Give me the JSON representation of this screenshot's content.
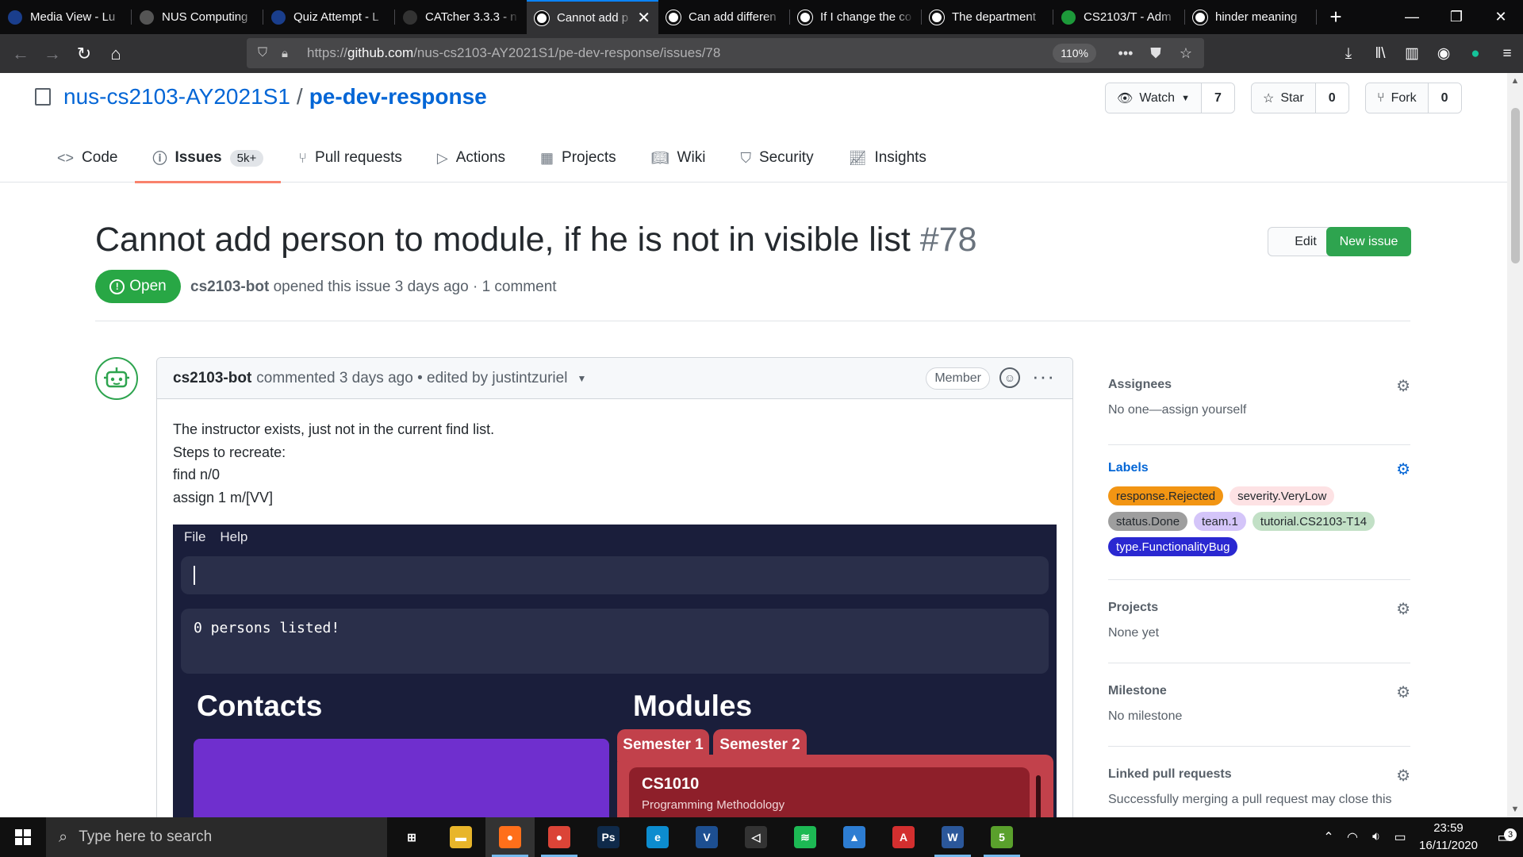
{
  "browser": {
    "tabs": [
      {
        "title": "Media View - Lu",
        "icon": "luminus-icon",
        "color": "#1a3e8c"
      },
      {
        "title": "NUS Computing",
        "icon": "shield-crest-icon",
        "color": "#555"
      },
      {
        "title": "Quiz Attempt - L",
        "icon": "luminus-icon",
        "color": "#1a3e8c"
      },
      {
        "title": "CATcher 3.3.3 - n",
        "icon": "catcher-icon",
        "color": "#333"
      },
      {
        "title": "Cannot add p",
        "icon": "github-icon",
        "color": "#fff",
        "active": true
      },
      {
        "title": "Can add differen",
        "icon": "github-icon",
        "color": "#fff"
      },
      {
        "title": "If I change the co",
        "icon": "github-icon",
        "color": "#fff"
      },
      {
        "title": "The department",
        "icon": "github-icon",
        "color": "#fff"
      },
      {
        "title": "CS2103/T - Adm",
        "icon": "graduation-cap-icon",
        "color": "#1d9a3a"
      },
      {
        "title": "hinder meaning",
        "icon": "google-icon",
        "color": "#fff"
      }
    ],
    "url_prefix": "https://",
    "url_host": "github.com",
    "url_path": "/nus-cs2103-AY2021S1/pe-dev-response/issues/78",
    "zoom": "110%"
  },
  "repo": {
    "owner": "nus-cs2103-AY2021S1",
    "separator": "/",
    "name": "pe-dev-response",
    "watch_label": "Watch",
    "watch_count": "7",
    "star_label": "Star",
    "star_count": "0",
    "fork_label": "Fork",
    "fork_count": "0",
    "nav": [
      {
        "label": "Code",
        "icon": "code-icon"
      },
      {
        "label": "Issues",
        "icon": "issue-opened-icon",
        "count": "5k+",
        "selected": true
      },
      {
        "label": "Pull requests",
        "icon": "git-pull-request-icon"
      },
      {
        "label": "Actions",
        "icon": "play-icon"
      },
      {
        "label": "Projects",
        "icon": "project-icon"
      },
      {
        "label": "Wiki",
        "icon": "book-icon"
      },
      {
        "label": "Security",
        "icon": "shield-icon"
      },
      {
        "label": "Insights",
        "icon": "graph-icon"
      }
    ]
  },
  "issue": {
    "title": "Cannot add person to module, if he is not in visible list",
    "number": "#78",
    "edit_label": "Edit",
    "new_issue_label": "New issue",
    "state": "Open",
    "author": "cs2103-bot",
    "meta_rest": "opened this issue 3 days ago · 1 comment"
  },
  "comment": {
    "author": "cs2103-bot",
    "meta": "commented 3 days ago • edited by justintzuriel",
    "badge": "Member",
    "body_lines": [
      "The instructor exists, just not in the current find list.",
      "Steps to recreate:",
      "find n/0",
      "assign 1 m/[VV]"
    ],
    "app": {
      "menu": [
        "File",
        "Help"
      ],
      "result": "0 persons listed!",
      "contacts_title": "Contacts",
      "modules_title": "Modules",
      "sem_tabs": [
        "Semester 1",
        "Semester 2"
      ],
      "module_code": "CS1010",
      "module_name": "Programming Methodology"
    }
  },
  "sidebar": {
    "assignees_title": "Assignees",
    "assignees_value": "No one—assign yourself",
    "labels_title": "Labels",
    "labels": [
      {
        "name": "response.Rejected",
        "color": "#f29513"
      },
      {
        "name": "severity.VeryLow",
        "color": "#fde2e4"
      },
      {
        "name": "status.Done",
        "color": "#9e9e9e"
      },
      {
        "name": "team.1",
        "color": "#d4c5f9"
      },
      {
        "name": "tutorial.CS2103-T14",
        "color": "#c2e0c6"
      },
      {
        "name": "type.FunctionalityBug",
        "color": "#2a28d1",
        "light_text": true
      }
    ],
    "projects_title": "Projects",
    "projects_value": "None yet",
    "milestone_title": "Milestone",
    "milestone_value": "No milestone",
    "linked_title": "Linked pull requests",
    "linked_value": "Successfully merging a pull request may close this"
  },
  "taskbar": {
    "search_placeholder": "Type here to search",
    "apps": [
      {
        "name": "task-view-icon",
        "label": "⊞",
        "bg": "transparent"
      },
      {
        "name": "file-explorer-icon",
        "label": "▬",
        "bg": "#e8b52a"
      },
      {
        "name": "firefox-icon",
        "label": "●",
        "bg": "#ff6f1a",
        "run": true,
        "act": true
      },
      {
        "name": "chrome-icon",
        "label": "●",
        "bg": "#db4437",
        "run": true
      },
      {
        "name": "photoshop-icon",
        "label": "Ps",
        "bg": "#0f2a4a"
      },
      {
        "name": "edge-icon",
        "label": "e",
        "bg": "#0c8ccf"
      },
      {
        "name": "virtualbox-icon",
        "label": "V",
        "bg": "#1d4f91"
      },
      {
        "name": "unity-icon",
        "label": "◁",
        "bg": "#333"
      },
      {
        "name": "spotify-icon",
        "label": "≋",
        "bg": "#1db954"
      },
      {
        "name": "photos-icon",
        "label": "▲",
        "bg": "#2d7dd2"
      },
      {
        "name": "acrobat-icon",
        "label": "A",
        "bg": "#d32f2f"
      },
      {
        "name": "word-icon",
        "label": "W",
        "bg": "#2b579a",
        "run": true
      },
      {
        "name": "greenshot-icon",
        "label": "5",
        "bg": "#5aa02c",
        "run": true
      }
    ],
    "time": "23:59",
    "date": "16/11/2020",
    "notification_count": "3"
  }
}
